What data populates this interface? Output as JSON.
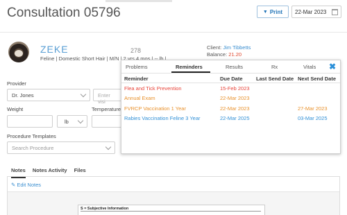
{
  "header": {
    "title": "Consultation 05796",
    "print_label": "Print",
    "date": "22-Mar 2023"
  },
  "patient": {
    "name": "ZEKE",
    "description": "Feline | Domestic Short Hair | M/N | 2 yrs 4 mos | -- lb |",
    "number": "278",
    "client_label": "Client:",
    "client_name": "Jim Tibbetts",
    "balance_label": "Balance:",
    "balance": "21.20"
  },
  "form": {
    "provider_label": "Provider",
    "provider_value": "Dr. Jones",
    "visit_placeholder": "Enter visi",
    "weight_label": "Weight",
    "weight_value": "",
    "weight_unit": "lb",
    "temperature_label": "Temperature",
    "procedure_label": "Procedure Templates",
    "procedure_placeholder": "Search Procedure"
  },
  "notes_tabs": [
    "Notes",
    "Notes Activity",
    "Files"
  ],
  "edit_notes_label": "Edit Notes",
  "subjective_heading": "S = Subjective Information",
  "popup": {
    "tabs": [
      "Problems",
      "Reminders",
      "Results",
      "Rx",
      "Vitals"
    ],
    "active_tab": "Reminders",
    "columns": [
      "Reminder",
      "Due Date",
      "Last Send Date",
      "Next Send Date"
    ],
    "rows": [
      {
        "reminder": "Flea and Tick Prevention",
        "due": "15-Feb 2023",
        "last": "",
        "next": "",
        "color": "#e8443a"
      },
      {
        "reminder": "Annual Exam",
        "due": "22-Mar 2023",
        "last": "",
        "next": "",
        "color": "#e8912c"
      },
      {
        "reminder": "FVRCP Vaccination 1 Year",
        "due": "22-Mar 2023",
        "last": "",
        "next": "27-Mar 2023",
        "color": "#e8912c"
      },
      {
        "reminder": "Rabies Vaccination Feline 3 Year",
        "due": "22-Mar 2025",
        "last": "",
        "next": "03-Mar 2025",
        "color": "#2f8fd6"
      }
    ]
  },
  "colors": {
    "accent": "#1f73b7",
    "overdue": "#e8443a",
    "due": "#e8912c",
    "future": "#2f8fd6"
  }
}
